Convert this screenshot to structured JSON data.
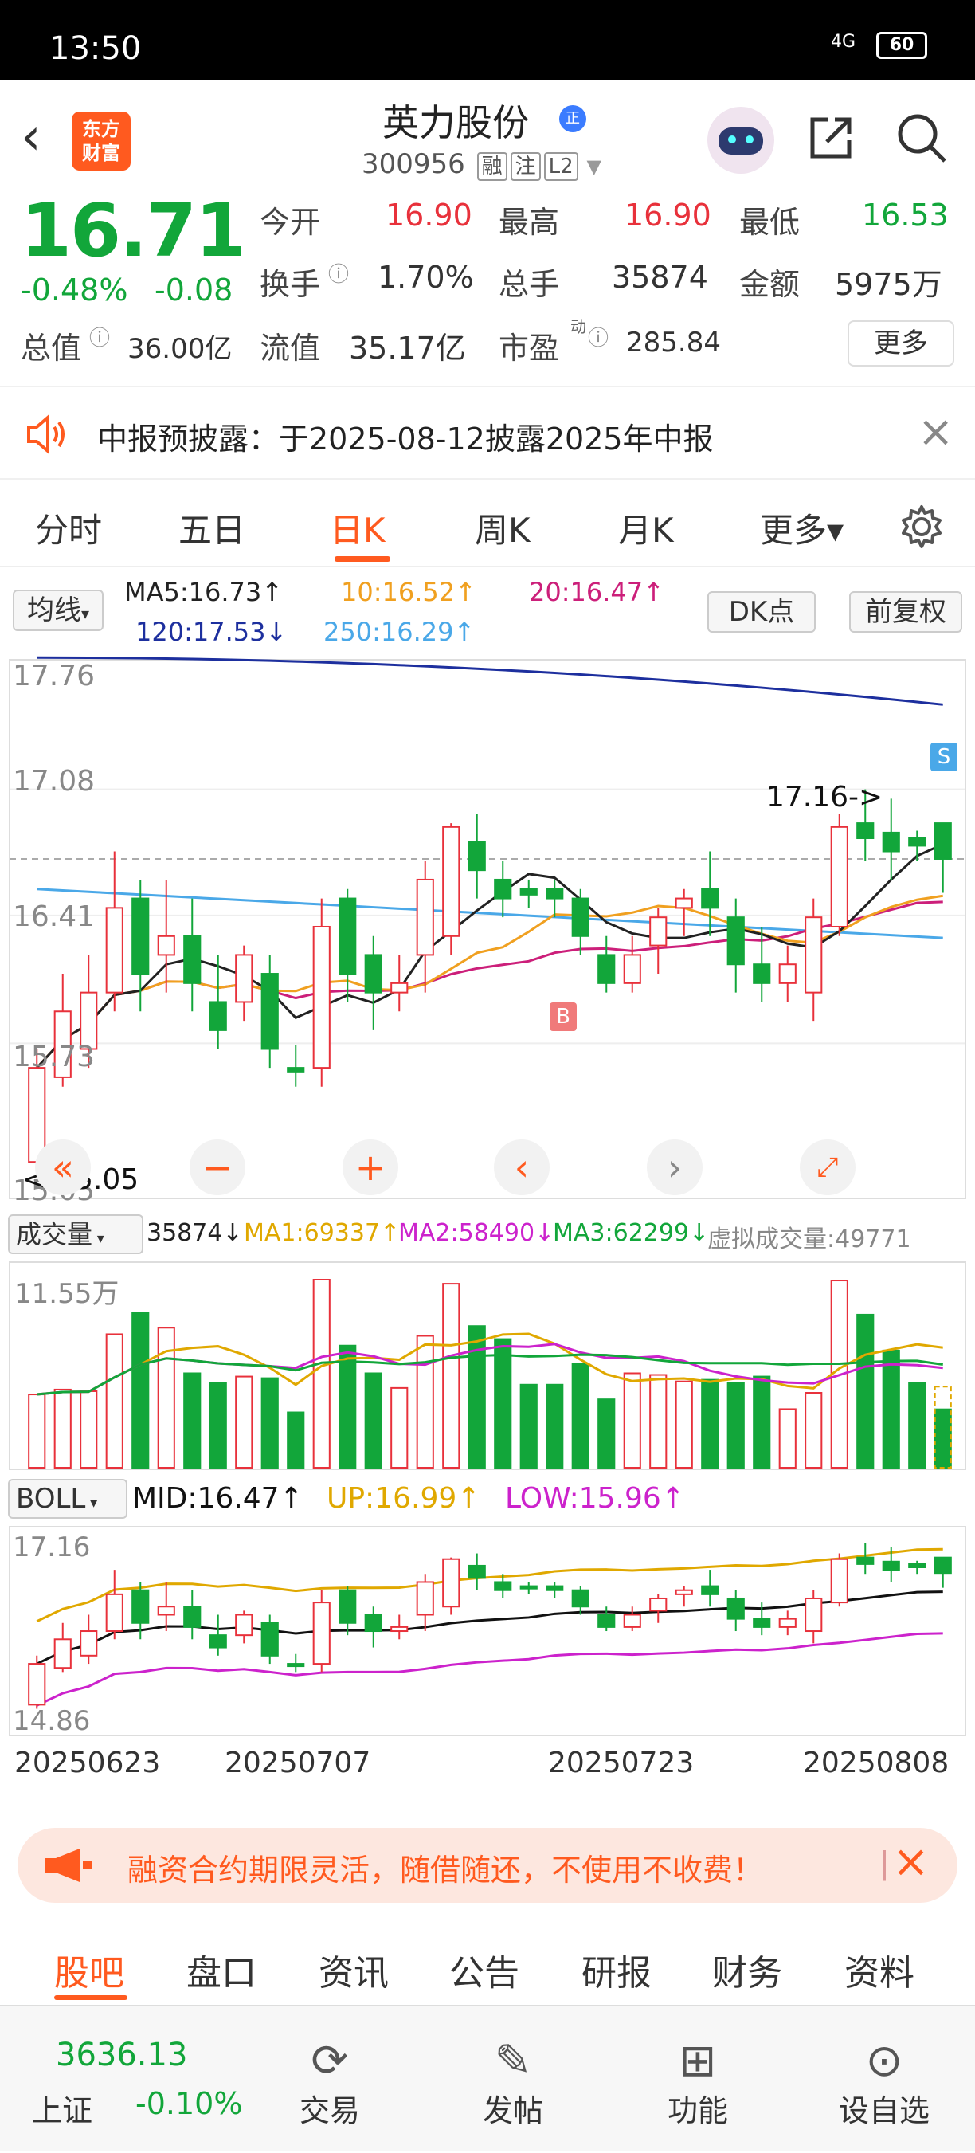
{
  "status_bar": {
    "time": "13:50",
    "signal": "4G",
    "battery": "60"
  },
  "header": {
    "back_icon": "chevron-left-icon",
    "logo_line1": "东方",
    "logo_line2": "财富",
    "stock_name": "英力股份",
    "badge": "正",
    "code": "300956",
    "tags": [
      "融",
      "注",
      "L2"
    ],
    "share_icon": "share-icon",
    "search_icon": "search-icon"
  },
  "quote": {
    "price": "16.71",
    "change_pct": "-0.48%",
    "change": "-0.08",
    "open_label": "今开",
    "open": "16.90",
    "high_label": "最高",
    "high": "16.90",
    "low_label": "最低",
    "low": "16.53",
    "turnover_label": "换手",
    "turnover": "1.70%",
    "volume_label": "总手",
    "volume": "35874",
    "amount_label": "金额",
    "amount": "5975万",
    "mktcap_label": "总值",
    "mktcap": "36.00亿",
    "float_label": "流值",
    "float": "35.17亿",
    "pe_label": "市盈",
    "pe_sup": "动",
    "pe": "285.84",
    "more_label": "更多"
  },
  "notice": {
    "text": "中报预披露：于2025-08-12披露2025年中报"
  },
  "tabs": [
    "分时",
    "五日",
    "日K",
    "周K",
    "月K",
    "更多▾"
  ],
  "active_tab": "日K",
  "kline": {
    "ma_selector": "均线",
    "ma5": "MA5:16.73↑",
    "ma10": "10:16.52↑",
    "ma20": "20:16.47↑",
    "ma120": "120:17.53↓",
    "ma250": "250:16.29↑",
    "dk_button": "DK点",
    "adjust_button": "前复权",
    "y_labels": [
      "17.76",
      "17.08",
      "16.41",
      "15.73",
      "15.05"
    ],
    "high_note": "17.16->",
    "low_note": "<-15.05",
    "buy_marker": "B",
    "sell_marker": "S"
  },
  "volume": {
    "selector": "成交量",
    "current": "35874↓",
    "ma1": "MA1:69337↑",
    "ma2": "MA2:58490↓",
    "ma3": "MA3:62299↓",
    "virtual": "虚拟成交量:49771",
    "y_label": "11.55万"
  },
  "boll": {
    "selector": "BOLL",
    "mid": "MID:16.47↑",
    "up": "UP:16.99↑",
    "low": "LOW:15.96↑",
    "y_top": "17.16",
    "y_bottom": "14.86"
  },
  "dates": [
    "20250623",
    "20250707",
    "20250723",
    "20250808"
  ],
  "promo": {
    "text": "融资合约期限灵活，随借随还，不使用不收费！"
  },
  "subtabs": [
    "股吧",
    "盘口",
    "资讯",
    "公告",
    "研报",
    "财务",
    "资料"
  ],
  "active_subtab": "股吧",
  "bottom": {
    "index_value": "3636.13",
    "index_name": "上证",
    "index_change": "-0.10%",
    "items": [
      "交易",
      "发帖",
      "功能",
      "设自选"
    ]
  },
  "colors": {
    "up": "#e8313b",
    "down": "#12a63a",
    "accent": "#ff5a1f"
  },
  "chart_data": {
    "type": "candlestick",
    "x_start": "20250623",
    "x_end": "20250808",
    "ylim": [
      15.05,
      17.76
    ],
    "candles": [
      {
        "o": 15.1,
        "c": 15.6,
        "h": 15.7,
        "l": 15.05
      },
      {
        "o": 15.55,
        "c": 15.9,
        "h": 16.1,
        "l": 15.5
      },
      {
        "o": 15.7,
        "c": 16.0,
        "h": 16.2,
        "l": 15.6
      },
      {
        "o": 16.0,
        "c": 16.45,
        "h": 16.75,
        "l": 15.9
      },
      {
        "o": 16.5,
        "c": 16.1,
        "h": 16.6,
        "l": 15.9
      },
      {
        "o": 16.2,
        "c": 16.3,
        "h": 16.6,
        "l": 16.0
      },
      {
        "o": 16.3,
        "c": 16.05,
        "h": 16.5,
        "l": 15.9
      },
      {
        "o": 15.95,
        "c": 15.8,
        "h": 16.2,
        "l": 15.7
      },
      {
        "o": 15.95,
        "c": 16.2,
        "h": 16.25,
        "l": 15.85
      },
      {
        "o": 16.1,
        "c": 15.7,
        "h": 16.2,
        "l": 15.6
      },
      {
        "o": 15.6,
        "c": 15.58,
        "h": 15.72,
        "l": 15.5
      },
      {
        "o": 15.6,
        "c": 16.35,
        "h": 16.5,
        "l": 15.5
      },
      {
        "o": 16.5,
        "c": 16.1,
        "h": 16.55,
        "l": 15.95
      },
      {
        "o": 16.2,
        "c": 16.0,
        "h": 16.3,
        "l": 15.8
      },
      {
        "o": 16.0,
        "c": 16.05,
        "h": 16.2,
        "l": 15.9
      },
      {
        "o": 16.2,
        "c": 16.6,
        "h": 16.7,
        "l": 16.0
      },
      {
        "o": 16.3,
        "c": 16.88,
        "h": 16.9,
        "l": 16.2
      },
      {
        "o": 16.8,
        "c": 16.65,
        "h": 16.95,
        "l": 16.5
      },
      {
        "o": 16.6,
        "c": 16.5,
        "h": 16.7,
        "l": 16.4
      },
      {
        "o": 16.55,
        "c": 16.52,
        "h": 16.6,
        "l": 16.45
      },
      {
        "o": 16.55,
        "c": 16.5,
        "h": 16.6,
        "l": 16.4
      },
      {
        "o": 16.5,
        "c": 16.3,
        "h": 16.55,
        "l": 16.2
      },
      {
        "o": 16.2,
        "c": 16.05,
        "h": 16.3,
        "l": 16.0
      },
      {
        "o": 16.05,
        "c": 16.2,
        "h": 16.3,
        "l": 16.0
      },
      {
        "o": 16.25,
        "c": 16.4,
        "h": 16.45,
        "l": 16.1
      },
      {
        "o": 16.45,
        "c": 16.5,
        "h": 16.55,
        "l": 16.3
      },
      {
        "o": 16.55,
        "c": 16.45,
        "h": 16.75,
        "l": 16.3
      },
      {
        "o": 16.4,
        "c": 16.15,
        "h": 16.5,
        "l": 16.0
      },
      {
        "o": 16.15,
        "c": 16.05,
        "h": 16.35,
        "l": 15.95
      },
      {
        "o": 16.05,
        "c": 16.15,
        "h": 16.25,
        "l": 15.95
      },
      {
        "o": 16.0,
        "c": 16.4,
        "h": 16.5,
        "l": 15.85
      },
      {
        "o": 16.35,
        "c": 16.88,
        "h": 16.95,
        "l": 16.3
      },
      {
        "o": 16.9,
        "c": 16.82,
        "h": 17.08,
        "l": 16.7
      },
      {
        "o": 16.85,
        "c": 16.75,
        "h": 17.03,
        "l": 16.6
      },
      {
        "o": 16.82,
        "c": 16.78,
        "h": 16.86,
        "l": 16.7
      },
      {
        "o": 16.9,
        "c": 16.71,
        "h": 16.9,
        "l": 16.53
      }
    ],
    "volume": [
      45000,
      48000,
      47000,
      82000,
      95000,
      86000,
      58000,
      52000,
      56000,
      55000,
      34000,
      115500,
      75000,
      58000,
      49000,
      81000,
      113000,
      87000,
      79000,
      51000,
      51000,
      64000,
      42000,
      58000,
      57000,
      53000,
      54000,
      52000,
      56000,
      36000,
      46000,
      115000,
      94000,
      72000,
      52000,
      35874
    ]
  }
}
